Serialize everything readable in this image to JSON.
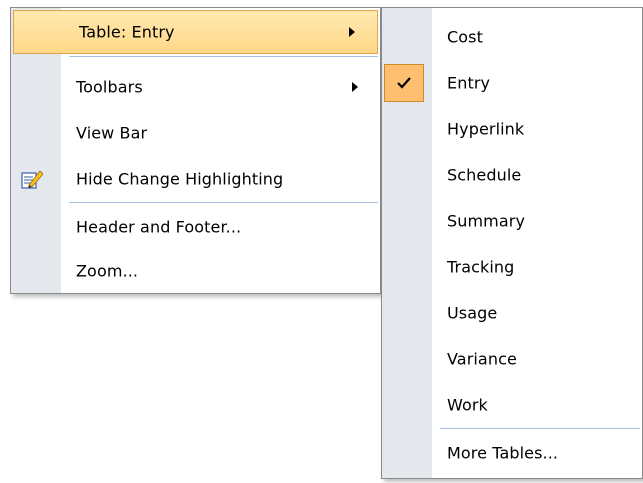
{
  "main_menu": {
    "items": [
      {
        "label": "Table: Entry",
        "has_submenu": true,
        "highlighted": true
      },
      {
        "label": "Toolbars",
        "has_submenu": true
      },
      {
        "label": "View Bar"
      },
      {
        "label": "Hide Change Highlighting",
        "icon": "highlight-pen-icon"
      },
      {
        "label": "Header and Footer..."
      },
      {
        "label": "Zoom..."
      }
    ]
  },
  "sub_menu": {
    "items": [
      {
        "label": "Cost"
      },
      {
        "label": "Entry",
        "checked": true
      },
      {
        "label": "Hyperlink"
      },
      {
        "label": "Schedule"
      },
      {
        "label": "Summary"
      },
      {
        "label": "Tracking"
      },
      {
        "label": "Usage"
      },
      {
        "label": "Variance"
      },
      {
        "label": "Work"
      },
      {
        "label": "More Tables..."
      }
    ]
  },
  "colors": {
    "gutter": "#e4e8ec",
    "highlight": "#ffd888",
    "separator": "#a7c1e4",
    "check_bg": "#ffbf70"
  }
}
